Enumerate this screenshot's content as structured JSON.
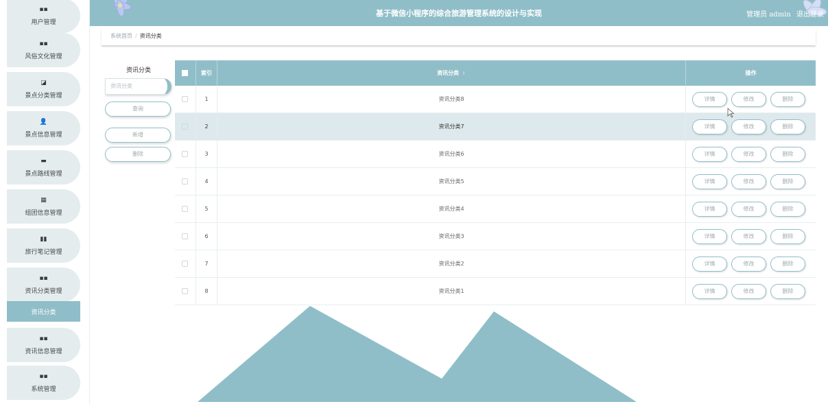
{
  "header": {
    "title": "基于微信小程序的综合旅游管理系统的设计与实现",
    "role_label": "管理员",
    "username": "admin",
    "logout_label": "退出登录"
  },
  "sidebar": {
    "items": [
      {
        "icon": "▪▪",
        "icon_name": "grid-icon",
        "label": "用户管理"
      },
      {
        "icon": "▪▪",
        "icon_name": "grid-icon",
        "label": "风俗文化管理"
      },
      {
        "icon": "◪",
        "icon_name": "image-icon",
        "label": "景点分类管理"
      },
      {
        "icon": "👤",
        "icon_name": "user-icon",
        "label": "景点信息管理"
      },
      {
        "icon": "▬",
        "icon_name": "monitor-icon",
        "label": "景点路线管理"
      },
      {
        "icon": "▦",
        "icon_name": "apps-icon",
        "label": "组团信息管理"
      },
      {
        "icon": "▮▮",
        "icon_name": "bar-chart-icon",
        "label": "旅行笔记管理"
      },
      {
        "icon": "▪▪",
        "icon_name": "grid-icon",
        "label": "资讯分类管理"
      },
      {
        "icon": "▪▪",
        "icon_name": "grid-icon",
        "label": "资讯信息管理"
      },
      {
        "icon": "▪▪",
        "icon_name": "grid-icon",
        "label": "系统管理"
      }
    ],
    "active_submenu": "资讯分类"
  },
  "breadcrumb": {
    "home": "系统首页",
    "separator": "/",
    "current": "资讯分类"
  },
  "search": {
    "title": "资讯分类",
    "placeholder": "资讯分类",
    "query_label": "查询",
    "add_label": "新增",
    "delete_label": "删除"
  },
  "table": {
    "headers": {
      "index": "索引",
      "name": "资讯分类",
      "sort_icon": "⇕",
      "actions": "操作"
    },
    "action_labels": {
      "detail": "详情",
      "edit": "修改",
      "delete": "删除"
    },
    "rows": [
      {
        "index": "1",
        "name": "资讯分类8"
      },
      {
        "index": "2",
        "name": "资讯分类7"
      },
      {
        "index": "3",
        "name": "资讯分类6"
      },
      {
        "index": "4",
        "name": "资讯分类5"
      },
      {
        "index": "5",
        "name": "资讯分类4"
      },
      {
        "index": "6",
        "name": "资讯分类3"
      },
      {
        "index": "7",
        "name": "资讯分类2"
      },
      {
        "index": "8",
        "name": "资讯分类1"
      }
    ]
  },
  "colors": {
    "accent": "#90bec8",
    "menu_bg": "#e4ecee",
    "row_highlight": "#dde9ec"
  }
}
